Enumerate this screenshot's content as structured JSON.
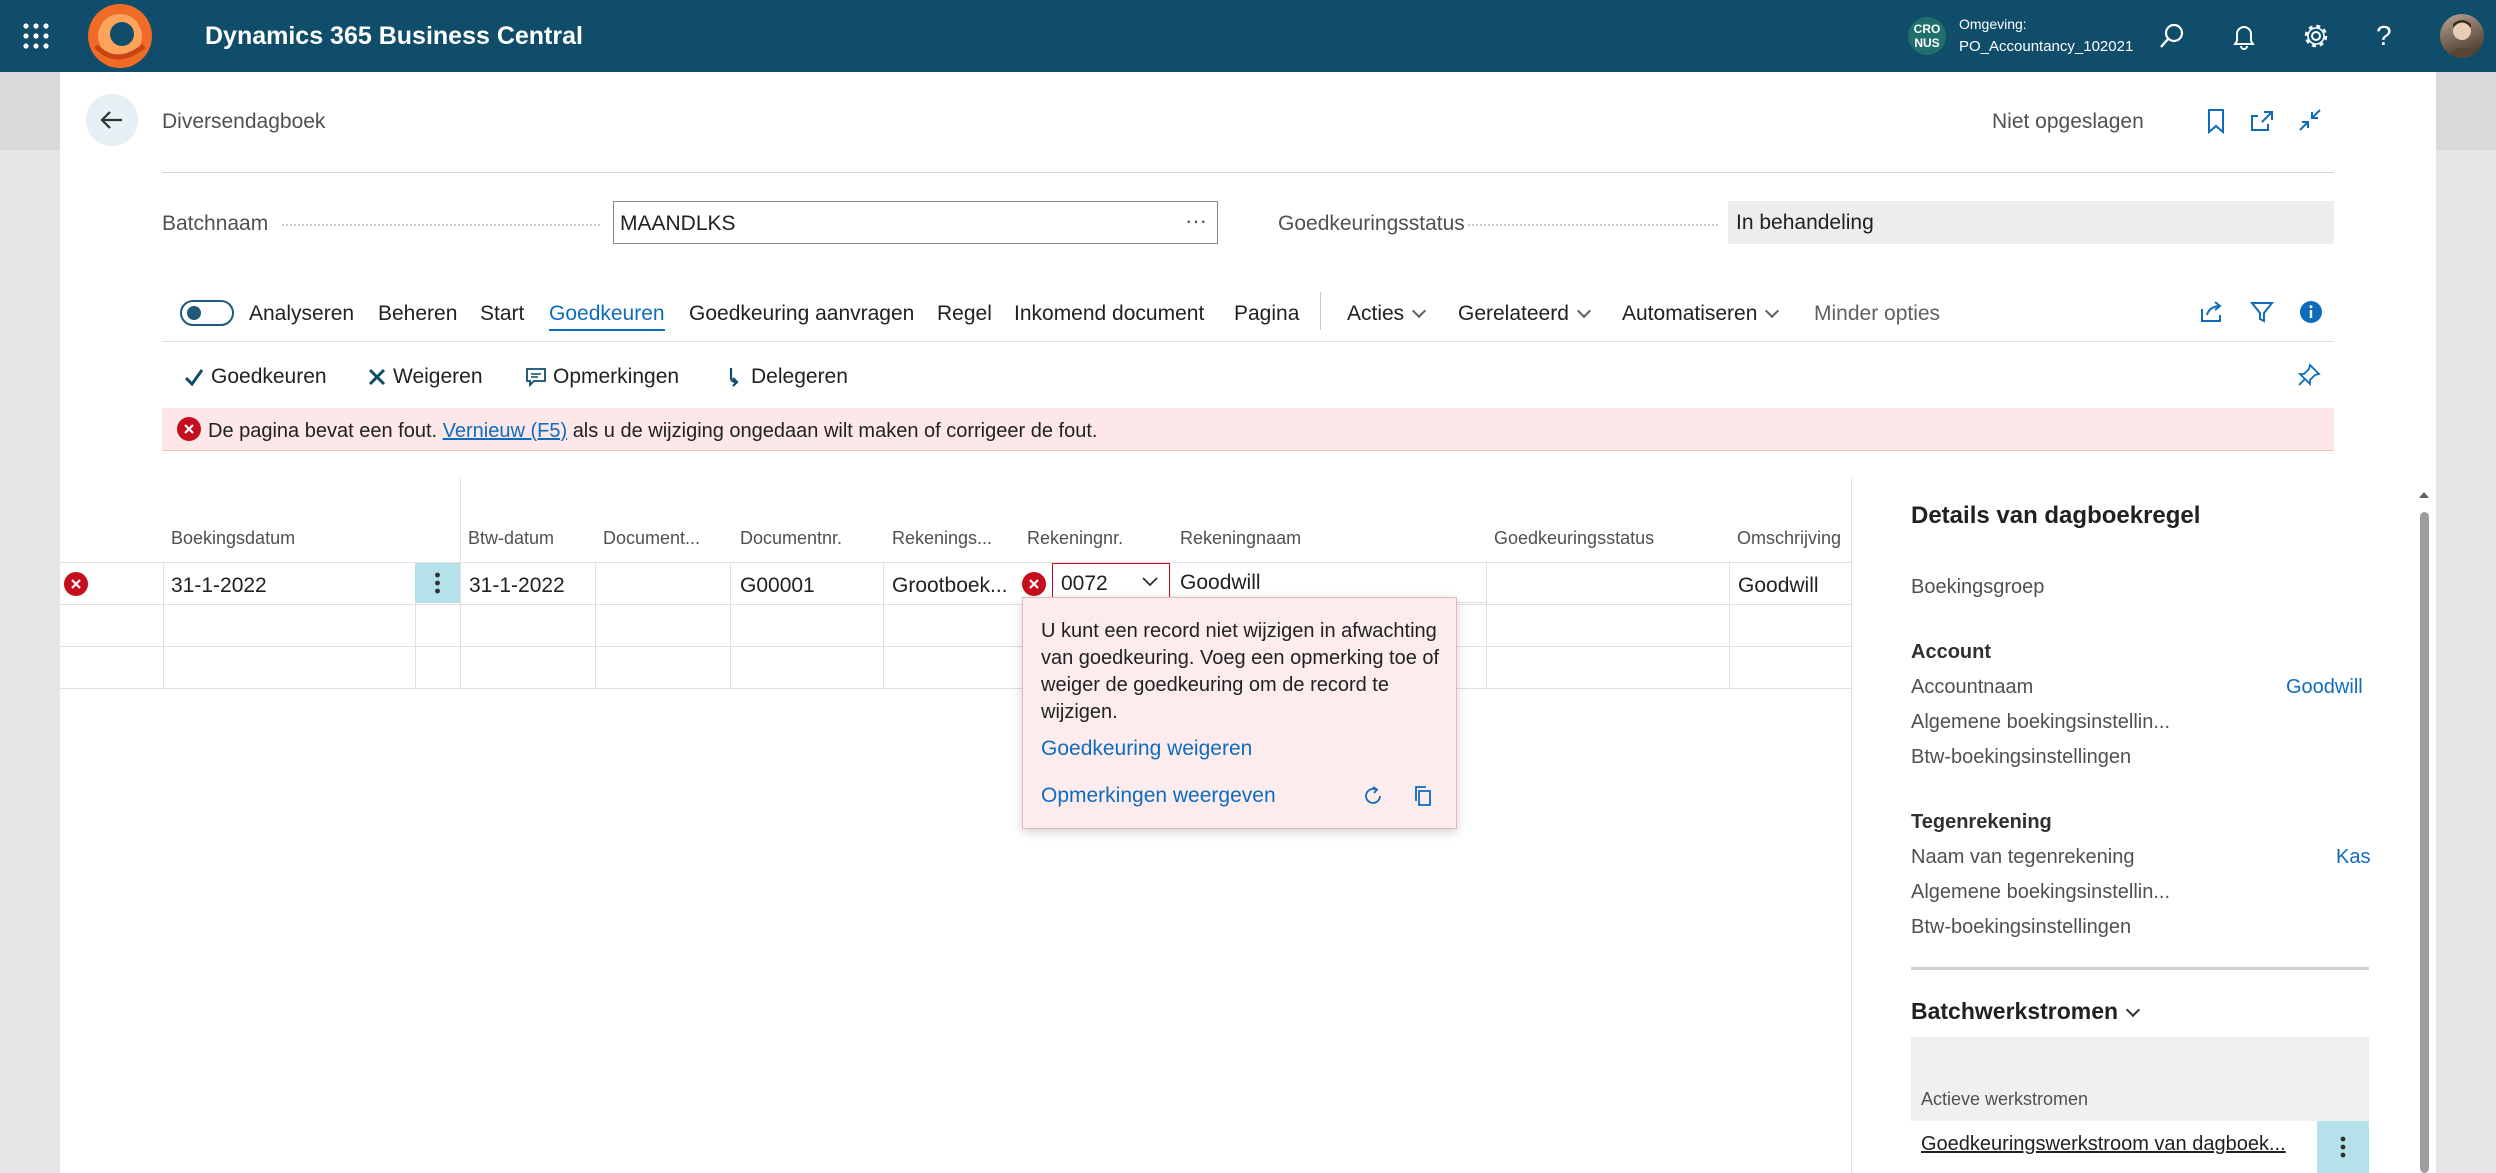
{
  "app": {
    "title": "Dynamics 365 Business Central",
    "company_badge": "CRO NUS",
    "env_label": "Omgeving:",
    "env_value": "PO_Accountancy_102021"
  },
  "page": {
    "title": "Diversendagboek",
    "save_status": "Niet opgeslagen"
  },
  "header_fields": {
    "batch_label": "Batchnaam",
    "batch_value": "MAANDLKS",
    "approval_label": "Goedkeuringsstatus",
    "approval_value": "In behandeling"
  },
  "action_bar": {
    "items": [
      "Analyseren",
      "Beheren",
      "Start",
      "Goedkeuren",
      "Goedkeuring aanvragen",
      "Regel",
      "Inkomend document",
      "Pagina"
    ],
    "dropdowns": [
      "Acties",
      "Gerelateerd",
      "Automatiseren"
    ],
    "fewer_options": "Minder opties",
    "active": "Goedkeuren"
  },
  "sub_actions": [
    "Goedkeuren",
    "Weigeren",
    "Opmerkingen",
    "Delegeren"
  ],
  "error_banner": {
    "prefix": "De pagina bevat een fout.",
    "link": "Vernieuw (F5)",
    "suffix": "als u de wijziging ongedaan wilt maken of corrigeer de fout."
  },
  "grid": {
    "columns": [
      "Boekingsdatum",
      "Btw-datum",
      "Document...",
      "Documentnr.",
      "Rekenings...",
      "Rekeningnr.",
      "Rekeningnaam",
      "Goedkeuringsstatus",
      "Omschrijving"
    ],
    "row": {
      "boekingsdatum": "31-1-2022",
      "btw_datum": "31-1-2022",
      "documentsoort": "",
      "documentnr": "G00001",
      "rekeningsoort": "Grootboek...",
      "rekeningnr": "0072",
      "rekeningnaam": "Goodwill",
      "goedkeuringsstatus": "",
      "omschrijving": "Goodwill"
    }
  },
  "error_popup": {
    "message": "U kunt een record niet wijzigen in afwachting van goedkeuring. Voeg een opmerking toe of weiger de goedkeuring om de record te wijzigen.",
    "reject_link": "Goedkeuring weigeren",
    "comments_link": "Opmerkingen weergeven"
  },
  "details_panel": {
    "title": "Details van dagboekregel",
    "boekingsgroep": "Boekingsgroep",
    "account_heading": "Account",
    "accountnaam_label": "Accountnaam",
    "accountnaam_value": "Goodwill",
    "alg_boeking": "Algemene boekingsinstellin...",
    "btw_boeking": "Btw-boekingsinstellingen",
    "tegen_heading": "Tegenrekening",
    "tegen_naam_label": "Naam van tegenrekening",
    "tegen_naam_value": "Kas",
    "tegen_alg_boeking": "Algemene boekingsinstellin...",
    "tegen_btw_boeking": "Btw-boekingsinstellingen",
    "workflows_heading": "Batchwerkstromen",
    "active_workflows_label": "Actieve werkstromen",
    "workflow_name": "Goedkeuringswerkstroom van dagboek..."
  },
  "colors": {
    "header_bg": "#0f4d6b",
    "accent": "#0f6cbd",
    "error": "#c50f1f",
    "error_bg": "#fde7e9"
  }
}
